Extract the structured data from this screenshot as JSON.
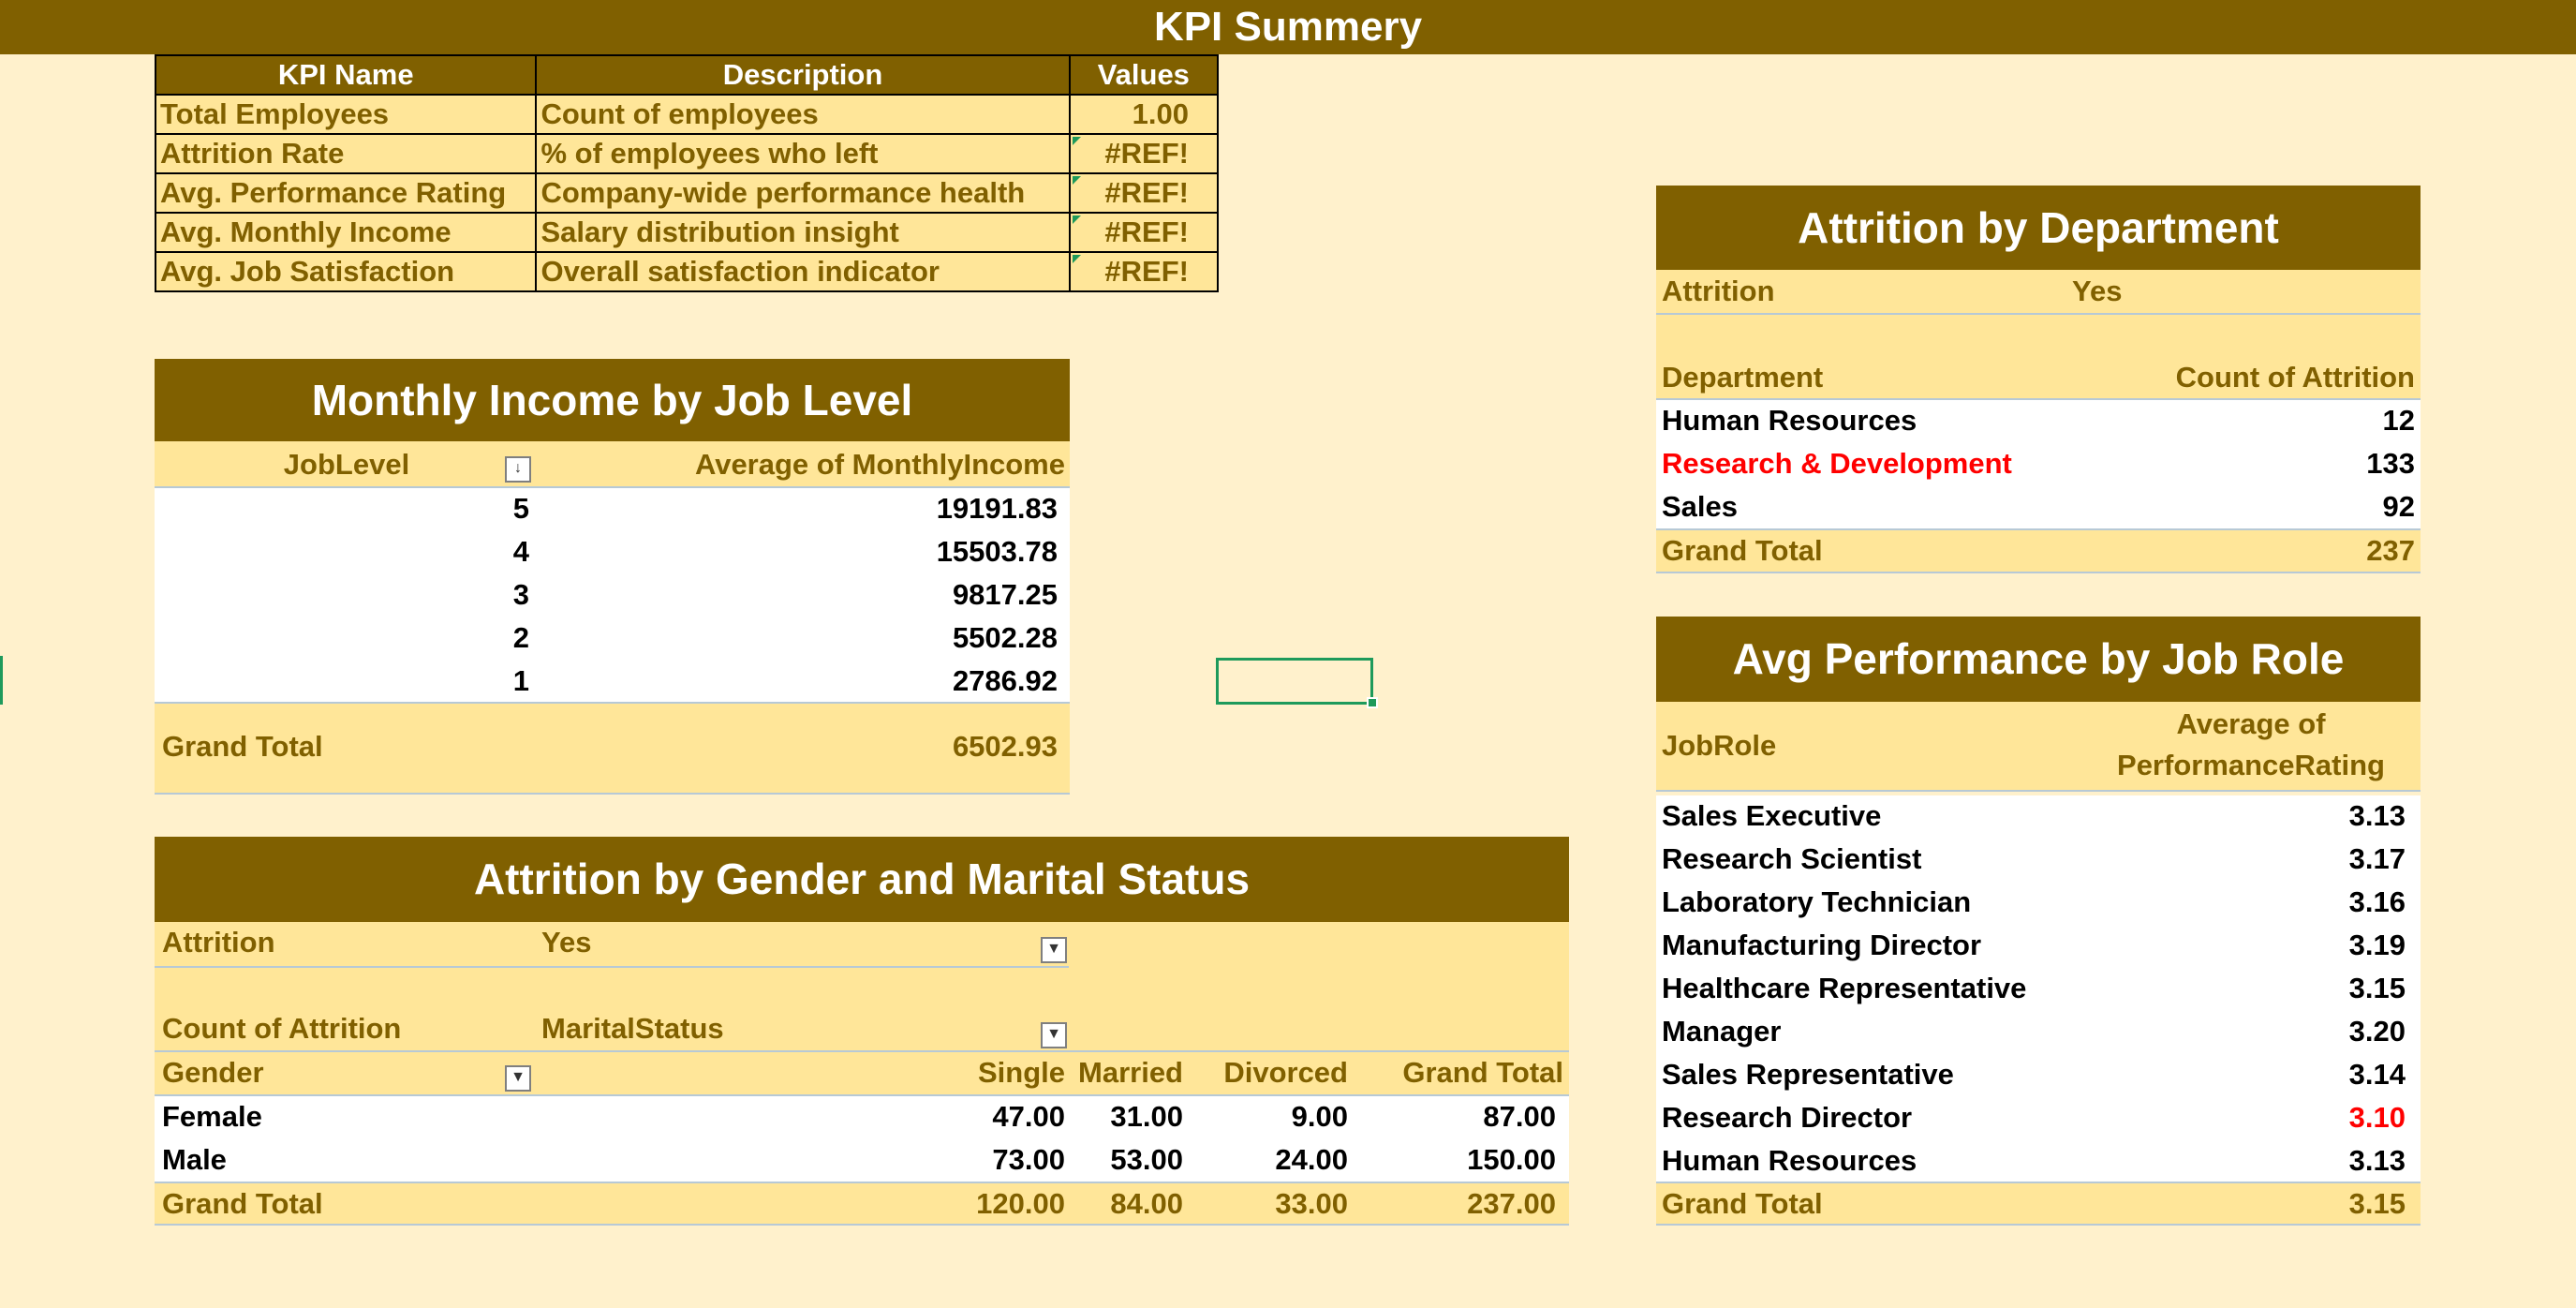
{
  "title": "KPI Summery",
  "kpi_table": {
    "headers": [
      "KPI Name",
      "Description",
      "Values"
    ],
    "rows": [
      {
        "name": "Total Employees",
        "desc": "Count of employees",
        "value": "1.00"
      },
      {
        "name": "Attrition Rate",
        "desc": "% of employees who left",
        "value": "#REF!"
      },
      {
        "name": "Avg. Performance Rating",
        "desc": "Company-wide performance health",
        "value": "#REF!"
      },
      {
        "name": "Avg. Monthly Income",
        "desc": "Salary distribution insight",
        "value": "#REF!"
      },
      {
        "name": "Avg. Job Satisfaction",
        "desc": "Overall satisfaction indicator",
        "value": "#REF!"
      }
    ]
  },
  "income_pivot": {
    "title": "Monthly Income by Job Level",
    "col1": "JobLevel",
    "col2": "Average of MonthlyIncome",
    "rows": [
      {
        "level": "5",
        "value": "19191.83"
      },
      {
        "level": "4",
        "value": "15503.78"
      },
      {
        "level": "3",
        "value": "9817.25"
      },
      {
        "level": "2",
        "value": "5502.28"
      },
      {
        "level": "1",
        "value": "2786.92"
      }
    ],
    "total_label": "Grand Total",
    "total_value": "6502.93"
  },
  "gender_pivot": {
    "title": "Attrition by Gender and Marital Status",
    "filter_label": "Attrition",
    "filter_value": "Yes",
    "measure_label": "Count of Attrition",
    "column_field": "MaritalStatus",
    "row_field": "Gender",
    "columns": [
      "Single",
      "Married",
      "Divorced",
      "Grand Total"
    ],
    "rows": [
      {
        "label": "Female",
        "values": [
          "47.00",
          "31.00",
          "9.00",
          "87.00"
        ]
      },
      {
        "label": "Male",
        "values": [
          "73.00",
          "53.00",
          "24.00",
          "150.00"
        ]
      }
    ],
    "total": {
      "label": "Grand Total",
      "values": [
        "120.00",
        "84.00",
        "33.00",
        "237.00"
      ]
    }
  },
  "dept_pivot": {
    "title": "Attrition by Department",
    "filter_label": "Attrition",
    "filter_value": "Yes",
    "col1": "Department",
    "col2": "Count of Attrition",
    "rows": [
      {
        "label": "Human Resources",
        "value": "12"
      },
      {
        "label": "Research & Development",
        "value": "133"
      },
      {
        "label": "Sales",
        "value": "92"
      }
    ],
    "total_label": "Grand Total",
    "total_value": "237",
    "highlight_color": "#ff0000"
  },
  "role_pivot": {
    "title": "Avg Performance by Job Role",
    "col1": "JobRole",
    "col2_line1": "Average of",
    "col2_line2": "PerformanceRating",
    "rows": [
      {
        "label": "Sales Executive",
        "value": "3.13"
      },
      {
        "label": "Research Scientist",
        "value": "3.17"
      },
      {
        "label": "Laboratory Technician",
        "value": "3.16"
      },
      {
        "label": "Manufacturing Director",
        "value": "3.19"
      },
      {
        "label": "Healthcare Representative",
        "value": "3.15"
      },
      {
        "label": "Manager",
        "value": "3.20"
      },
      {
        "label": "Sales Representative",
        "value": "3.14"
      },
      {
        "label": "Research Director",
        "value": "3.10"
      },
      {
        "label": "Human Resources",
        "value": "3.13"
      }
    ],
    "total_label": "Grand Total",
    "total_value": "3.15"
  },
  "colors": {
    "banner": "#806000",
    "light": "#ffe699",
    "page": "#fff1cc",
    "selection": "#1e9a5b"
  }
}
